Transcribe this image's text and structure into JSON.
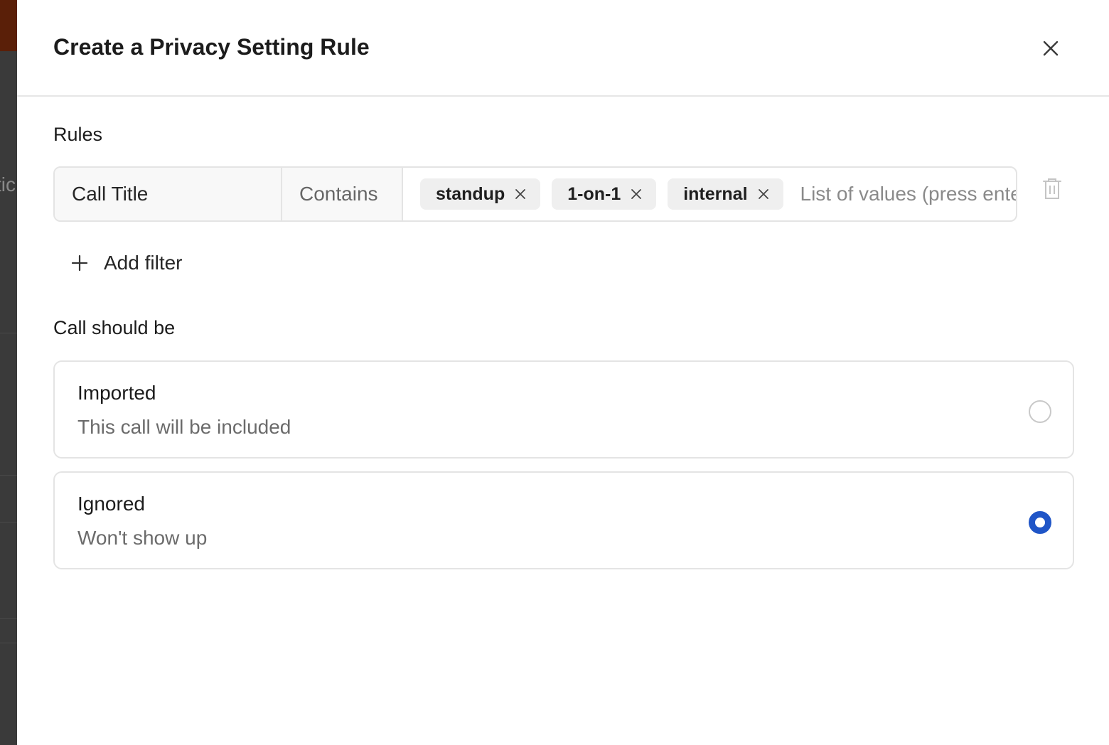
{
  "modal": {
    "title": "Create a Privacy Setting Rule"
  },
  "rules": {
    "label": "Rules",
    "field": "Call Title",
    "operator": "Contains",
    "chips": [
      "standup",
      "1-on-1",
      "internal"
    ],
    "values_placeholder": "List of values (press enter to add)",
    "add_filter_label": "Add filter"
  },
  "outcome": {
    "label": "Call should be",
    "options": [
      {
        "title": "Imported",
        "description": "This call will be included",
        "selected": false
      },
      {
        "title": "Ignored",
        "description": "Won't show up",
        "selected": true
      }
    ]
  },
  "colors": {
    "accent": "#1f55c7",
    "border": "#e4e4e4",
    "chip_bg": "#efefef"
  },
  "icons": {
    "close": "close-icon",
    "chip_remove": "x-icon",
    "delete": "trash-icon",
    "add": "plus-icon"
  }
}
